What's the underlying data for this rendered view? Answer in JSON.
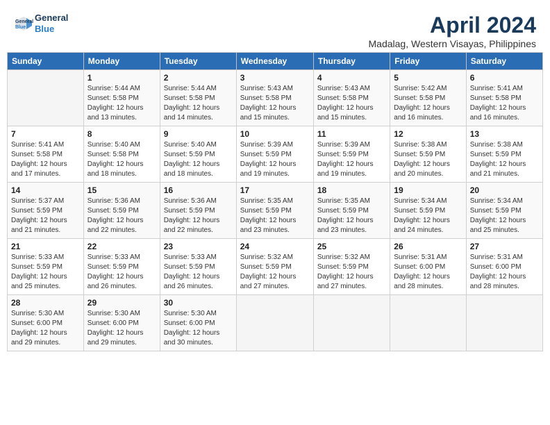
{
  "header": {
    "logo_line1": "General",
    "logo_line2": "Blue",
    "month_title": "April 2024",
    "location": "Madalag, Western Visayas, Philippines"
  },
  "columns": [
    "Sunday",
    "Monday",
    "Tuesday",
    "Wednesday",
    "Thursday",
    "Friday",
    "Saturday"
  ],
  "weeks": [
    [
      {
        "day": "",
        "info": ""
      },
      {
        "day": "1",
        "info": "Sunrise: 5:44 AM\nSunset: 5:58 PM\nDaylight: 12 hours\nand 13 minutes."
      },
      {
        "day": "2",
        "info": "Sunrise: 5:44 AM\nSunset: 5:58 PM\nDaylight: 12 hours\nand 14 minutes."
      },
      {
        "day": "3",
        "info": "Sunrise: 5:43 AM\nSunset: 5:58 PM\nDaylight: 12 hours\nand 15 minutes."
      },
      {
        "day": "4",
        "info": "Sunrise: 5:43 AM\nSunset: 5:58 PM\nDaylight: 12 hours\nand 15 minutes."
      },
      {
        "day": "5",
        "info": "Sunrise: 5:42 AM\nSunset: 5:58 PM\nDaylight: 12 hours\nand 16 minutes."
      },
      {
        "day": "6",
        "info": "Sunrise: 5:41 AM\nSunset: 5:58 PM\nDaylight: 12 hours\nand 16 minutes."
      }
    ],
    [
      {
        "day": "7",
        "info": "Sunrise: 5:41 AM\nSunset: 5:58 PM\nDaylight: 12 hours\nand 17 minutes."
      },
      {
        "day": "8",
        "info": "Sunrise: 5:40 AM\nSunset: 5:58 PM\nDaylight: 12 hours\nand 18 minutes."
      },
      {
        "day": "9",
        "info": "Sunrise: 5:40 AM\nSunset: 5:59 PM\nDaylight: 12 hours\nand 18 minutes."
      },
      {
        "day": "10",
        "info": "Sunrise: 5:39 AM\nSunset: 5:59 PM\nDaylight: 12 hours\nand 19 minutes."
      },
      {
        "day": "11",
        "info": "Sunrise: 5:39 AM\nSunset: 5:59 PM\nDaylight: 12 hours\nand 19 minutes."
      },
      {
        "day": "12",
        "info": "Sunrise: 5:38 AM\nSunset: 5:59 PM\nDaylight: 12 hours\nand 20 minutes."
      },
      {
        "day": "13",
        "info": "Sunrise: 5:38 AM\nSunset: 5:59 PM\nDaylight: 12 hours\nand 21 minutes."
      }
    ],
    [
      {
        "day": "14",
        "info": "Sunrise: 5:37 AM\nSunset: 5:59 PM\nDaylight: 12 hours\nand 21 minutes."
      },
      {
        "day": "15",
        "info": "Sunrise: 5:36 AM\nSunset: 5:59 PM\nDaylight: 12 hours\nand 22 minutes."
      },
      {
        "day": "16",
        "info": "Sunrise: 5:36 AM\nSunset: 5:59 PM\nDaylight: 12 hours\nand 22 minutes."
      },
      {
        "day": "17",
        "info": "Sunrise: 5:35 AM\nSunset: 5:59 PM\nDaylight: 12 hours\nand 23 minutes."
      },
      {
        "day": "18",
        "info": "Sunrise: 5:35 AM\nSunset: 5:59 PM\nDaylight: 12 hours\nand 23 minutes."
      },
      {
        "day": "19",
        "info": "Sunrise: 5:34 AM\nSunset: 5:59 PM\nDaylight: 12 hours\nand 24 minutes."
      },
      {
        "day": "20",
        "info": "Sunrise: 5:34 AM\nSunset: 5:59 PM\nDaylight: 12 hours\nand 25 minutes."
      }
    ],
    [
      {
        "day": "21",
        "info": "Sunrise: 5:33 AM\nSunset: 5:59 PM\nDaylight: 12 hours\nand 25 minutes."
      },
      {
        "day": "22",
        "info": "Sunrise: 5:33 AM\nSunset: 5:59 PM\nDaylight: 12 hours\nand 26 minutes."
      },
      {
        "day": "23",
        "info": "Sunrise: 5:33 AM\nSunset: 5:59 PM\nDaylight: 12 hours\nand 26 minutes."
      },
      {
        "day": "24",
        "info": "Sunrise: 5:32 AM\nSunset: 5:59 PM\nDaylight: 12 hours\nand 27 minutes."
      },
      {
        "day": "25",
        "info": "Sunrise: 5:32 AM\nSunset: 5:59 PM\nDaylight: 12 hours\nand 27 minutes."
      },
      {
        "day": "26",
        "info": "Sunrise: 5:31 AM\nSunset: 6:00 PM\nDaylight: 12 hours\nand 28 minutes."
      },
      {
        "day": "27",
        "info": "Sunrise: 5:31 AM\nSunset: 6:00 PM\nDaylight: 12 hours\nand 28 minutes."
      }
    ],
    [
      {
        "day": "28",
        "info": "Sunrise: 5:30 AM\nSunset: 6:00 PM\nDaylight: 12 hours\nand 29 minutes."
      },
      {
        "day": "29",
        "info": "Sunrise: 5:30 AM\nSunset: 6:00 PM\nDaylight: 12 hours\nand 29 minutes."
      },
      {
        "day": "30",
        "info": "Sunrise: 5:30 AM\nSunset: 6:00 PM\nDaylight: 12 hours\nand 30 minutes."
      },
      {
        "day": "",
        "info": ""
      },
      {
        "day": "",
        "info": ""
      },
      {
        "day": "",
        "info": ""
      },
      {
        "day": "",
        "info": ""
      }
    ]
  ]
}
